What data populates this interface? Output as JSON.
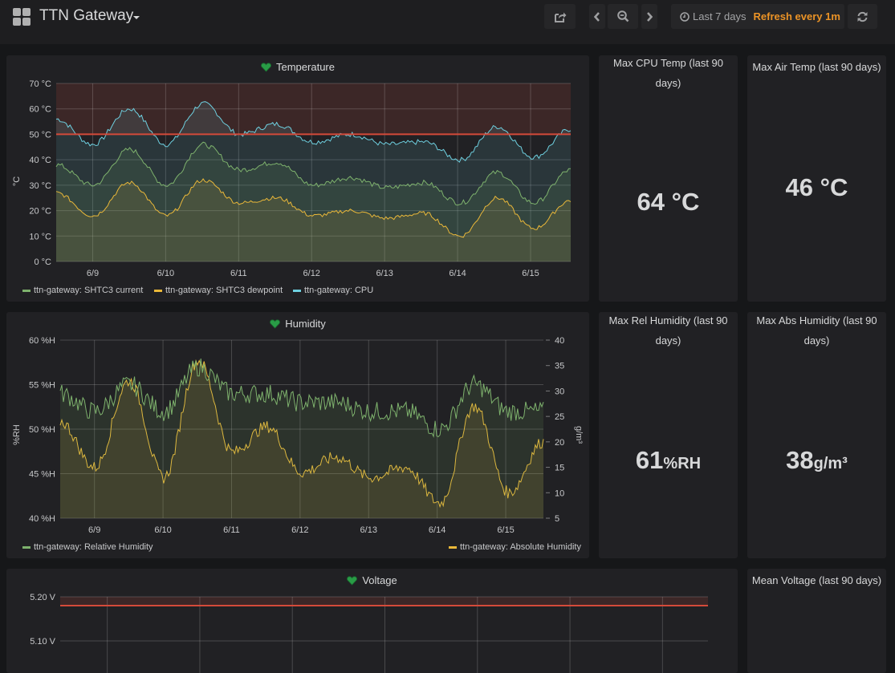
{
  "navbar": {
    "title": "TTN Gateway",
    "time_range": "Last 7 days",
    "refresh": "Refresh every 1m",
    "icons": [
      "dashboard-grid-icon",
      "share-icon",
      "chevron-left-icon",
      "zoom-out-icon",
      "chevron-right-icon",
      "clock-icon",
      "refresh-icon"
    ]
  },
  "panels": {
    "temperature": {
      "title": "Temperature",
      "ylabel": "°C",
      "y_ticks": [
        "70 °C",
        "60 °C",
        "50 °C",
        "40 °C",
        "30 °C",
        "20 °C",
        "10 °C",
        "0 °C"
      ],
      "x_ticks": [
        "6/9",
        "6/10",
        "6/11",
        "6/12",
        "6/13",
        "6/14",
        "6/15"
      ],
      "legend": [
        "ttn-gateway: SHTC3 current",
        "ttn-gateway: SHTC3 dewpoint",
        "ttn-gateway: CPU"
      ]
    },
    "max_cpu_temp": {
      "title": "Max CPU Temp (last 90 days)",
      "value": "64",
      "unit": " °C"
    },
    "max_air_temp": {
      "title": "Max Air Temp (last 90 days)",
      "value": "46",
      "unit": " °C"
    },
    "humidity": {
      "title": "Humidity",
      "ylabel_left": "%RH",
      "ylabel_right": "g/m³",
      "y_ticks_left": [
        "60 %H",
        "55 %H",
        "50 %H",
        "45 %H",
        "40 %H"
      ],
      "y_ticks_right": [
        "40",
        "35",
        "30",
        "25",
        "20",
        "15",
        "10",
        "5"
      ],
      "x_ticks": [
        "6/9",
        "6/10",
        "6/11",
        "6/12",
        "6/13",
        "6/14",
        "6/15"
      ],
      "legend_left": "ttn-gateway: Relative Humidity",
      "legend_right": "ttn-gateway: Absolute Humidity"
    },
    "max_rel_humidity": {
      "title": "Max Rel Humidity (last 90 days)",
      "value": "61",
      "unit": "%RH"
    },
    "max_abs_humidity": {
      "title": "Max Abs Humidity (last 90 days)",
      "value": "38",
      "unit": "g/m³"
    },
    "voltage": {
      "title": "Voltage",
      "y_ticks": [
        "5.20 V",
        "5.10 V"
      ]
    },
    "mean_voltage": {
      "title": "Mean Voltage (last 90 days)"
    }
  },
  "colors": {
    "current": "#7eb26d",
    "dewpoint": "#eab839",
    "cpu": "#6ed0e0",
    "threshold": "#d44a3a",
    "refresh": "#eb9326",
    "heart": "#299c46"
  },
  "chart_data": [
    {
      "type": "line",
      "title": "Temperature",
      "ylabel": "°C",
      "ylim": [
        0,
        70
      ],
      "x": [
        "6/8 12:00",
        "6/9",
        "6/9 12:00",
        "6/10",
        "6/10 12:00",
        "6/11",
        "6/11 12:00",
        "6/12",
        "6/12 12:00",
        "6/13",
        "6/13 12:00",
        "6/14",
        "6/14 12:00",
        "6/15",
        "6/15 12:00"
      ],
      "threshold": 50,
      "series": [
        {
          "name": "ttn-gateway: SHTC3 current",
          "values": [
            38,
            30,
            44,
            30,
            46,
            36,
            39,
            30,
            33,
            29,
            31,
            23,
            35,
            23,
            36
          ]
        },
        {
          "name": "ttn-gateway: SHTC3 dewpoint",
          "values": [
            27,
            18,
            31,
            18,
            32,
            23,
            25,
            18,
            20,
            17,
            19,
            10,
            25,
            13,
            24
          ]
        },
        {
          "name": "ttn-gateway: CPU",
          "values": [
            56,
            46,
            60,
            46,
            62,
            50,
            54,
            47,
            50,
            46,
            47,
            40,
            53,
            41,
            52
          ]
        }
      ],
      "legend": "bottom-left",
      "grid": true
    },
    {
      "type": "line",
      "title": "Humidity",
      "ylim_left": [
        40,
        60
      ],
      "ylim_right": [
        5,
        40
      ],
      "x": [
        "6/8 12:00",
        "6/9",
        "6/9 12:00",
        "6/10",
        "6/10 12:00",
        "6/11",
        "6/11 12:00",
        "6/12",
        "6/12 12:00",
        "6/13",
        "6/13 12:00",
        "6/14",
        "6/14 12:00",
        "6/15",
        "6/15 12:00"
      ],
      "series": [
        {
          "name": "ttn-gateway: Relative Humidity",
          "axis": "left",
          "values": [
            54,
            52,
            55,
            52,
            57,
            54,
            54,
            53,
            53,
            52,
            52,
            50,
            55,
            52,
            52
          ]
        },
        {
          "name": "ttn-gateway: Absolute Humidity",
          "axis": "right",
          "values": [
            24,
            15,
            32,
            13,
            36,
            18,
            23,
            14,
            17,
            13,
            15,
            8,
            27,
            10,
            20
          ]
        }
      ],
      "legend": "bottom",
      "grid": true
    },
    {
      "type": "line",
      "title": "Voltage",
      "y_ticks": [
        "5.20 V",
        "5.10 V"
      ],
      "threshold": 5.18,
      "series": []
    }
  ]
}
